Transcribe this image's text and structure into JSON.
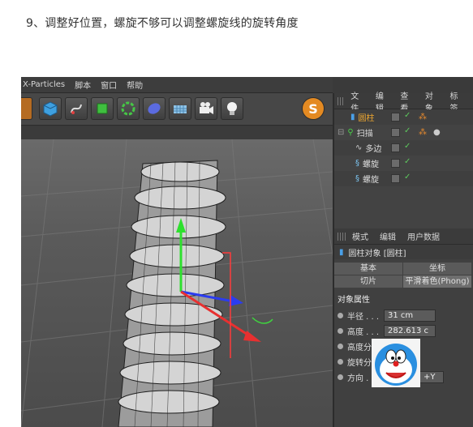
{
  "caption": "9、调整好位置，螺旋不够可以调整螺旋线的旋转角度",
  "menubar": [
    "X-Particles",
    "脚本",
    "窗口",
    "帮助"
  ],
  "object_manager": {
    "menu": [
      "文件",
      "编辑",
      "查看",
      "对象",
      "标签"
    ],
    "objects": [
      {
        "label": "圆柱",
        "highlight": true
      },
      {
        "label": "扫描",
        "highlight": false
      },
      {
        "label": "多边",
        "highlight": false
      },
      {
        "label": "螺旋",
        "highlight": false
      },
      {
        "label": "螺旋",
        "highlight": false
      }
    ]
  },
  "attribute_manager": {
    "menu": [
      "模式",
      "编辑",
      "用户数据"
    ],
    "title": "圆柱对象 [圆柱]",
    "tabs": [
      "基本",
      "坐标",
      "切片",
      "平滑着色(Phong)"
    ],
    "section": "对象属性",
    "props": [
      {
        "label": "半径 . . .",
        "value": "31 cm"
      },
      {
        "label": "高度 . . .",
        "value": "282.613 c"
      },
      {
        "label": "高度分",
        "value": ""
      },
      {
        "label": "旋转分",
        "value": ""
      },
      {
        "label": "方向 . . .",
        "value": "+Y"
      }
    ]
  },
  "toolbar_icons": [
    "render-icon",
    "cube-icon",
    "spline-pen-icon",
    "nurbs-icon",
    "array-icon",
    "deformer-icon",
    "floor-icon",
    "camera-icon",
    "light-icon",
    "scripting-icon"
  ],
  "accent": "#f08a1d"
}
